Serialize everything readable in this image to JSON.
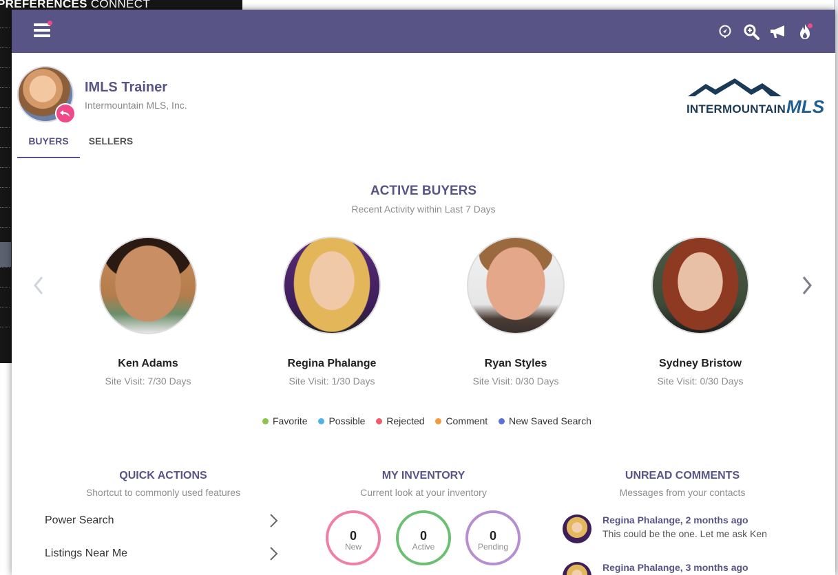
{
  "background_app": {
    "title_bold": "PREFERENCES",
    "title_rest": " CONNECT"
  },
  "topbar": {
    "menu_icon": "hamburger-menu-icon",
    "icons": [
      "location-pin-icon",
      "search-zoom-icon",
      "megaphone-icon",
      "flame-icon"
    ],
    "accent": "#585486",
    "notify_color": "#f0498a"
  },
  "profile": {
    "name": "IMLS Trainer",
    "company": "Intermountain MLS, Inc."
  },
  "logo": {
    "word": "INTERMOUNTAIN",
    "mark": "MLS"
  },
  "tabs": [
    {
      "label": "BUYERS",
      "active": true
    },
    {
      "label": "SELLERS",
      "active": false
    }
  ],
  "active_buyers": {
    "title": "ACTIVE BUYERS",
    "subtitle": "Recent Activity within Last 7 Days",
    "buyers": [
      {
        "name": "Ken Adams",
        "visit": "Site Visit: 7/30 Days"
      },
      {
        "name": "Regina Phalange",
        "visit": "Site Visit: 1/30 Days"
      },
      {
        "name": "Ryan Styles",
        "visit": "Site Visit: 0/30 Days"
      },
      {
        "name": "Sydney Bristow",
        "visit": "Site Visit: 0/30 Days"
      }
    ]
  },
  "legend": [
    {
      "label": "Favorite",
      "color": "#8bc34a"
    },
    {
      "label": "Possible",
      "color": "#4fb3e8"
    },
    {
      "label": "Rejected",
      "color": "#f05a6a"
    },
    {
      "label": "Comment",
      "color": "#f59a3c"
    },
    {
      "label": "New Saved Search",
      "color": "#5b6fd6"
    }
  ],
  "quick_actions": {
    "title": "QUICK ACTIONS",
    "subtitle": "Shortcut to commonly used features",
    "items": [
      {
        "label": "Power Search"
      },
      {
        "label": "Listings Near Me"
      }
    ]
  },
  "inventory": {
    "title": "MY INVENTORY",
    "subtitle": "Current look at your inventory",
    "stats": [
      {
        "value": "0",
        "label": "New",
        "color": "#f07fa4"
      },
      {
        "value": "0",
        "label": "Active",
        "color": "#6cc073"
      },
      {
        "value": "0",
        "label": "Pending",
        "color": "#b58fd0"
      }
    ]
  },
  "comments": {
    "title": "UNREAD COMMENTS",
    "subtitle": "Messages from your contacts",
    "items": [
      {
        "who": "Regina Phalange, 2 months ago",
        "message": "This could be the one. Let me ask Ken"
      },
      {
        "who": "Regina Phalange, 3 months ago",
        "message": ""
      }
    ]
  }
}
